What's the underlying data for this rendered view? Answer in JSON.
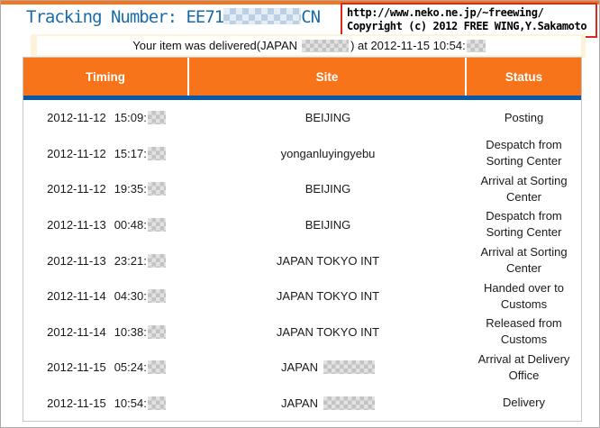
{
  "page": {
    "title_label": "Tracking Number: ",
    "tracking_prefix": "EE71",
    "tracking_suffix": "CN",
    "tracking_middle_redacted": true,
    "delivered_message": {
      "part1": "Your item was delivered(JAPAN",
      "site_redacted": true,
      "part2": ") at 2012-11-15 10:54:",
      "seconds_redacted": true
    },
    "copyright": {
      "line1": "http://www.neko.ne.jp/~freewing/",
      "line2": "Copyright (c) 2012 FREE WING,Y.Sakamoto"
    }
  },
  "colors": {
    "accent_orange": "#f7741b",
    "rule_blue": "#0858a8",
    "title_blue": "#1a6ba8",
    "copyright_border_red": "#e0271c",
    "message_band_cream": "#fcf3d9"
  },
  "table": {
    "headers": [
      "Timing",
      "Site",
      "Status"
    ],
    "rows": [
      {
        "date": "2012-11-12",
        "time": "15:09:",
        "seconds_redacted": true,
        "site": "BEIJING",
        "site_redacted": false,
        "status": "Posting"
      },
      {
        "date": "2012-11-12",
        "time": "15:17:",
        "seconds_redacted": true,
        "site": "yonganluyingyebu",
        "site_redacted": false,
        "status": "Despatch from Sorting Center"
      },
      {
        "date": "2012-11-12",
        "time": "19:35:",
        "seconds_redacted": true,
        "site": "BEIJING",
        "site_redacted": false,
        "status": "Arrival at Sorting Center"
      },
      {
        "date": "2012-11-13",
        "time": "00:48:",
        "seconds_redacted": true,
        "site": "BEIJING",
        "site_redacted": false,
        "status": "Despatch from Sorting Center"
      },
      {
        "date": "2012-11-13",
        "time": "23:21:",
        "seconds_redacted": true,
        "site": "JAPAN TOKYO INT",
        "site_redacted": false,
        "status": "Arrival at Sorting Center"
      },
      {
        "date": "2012-11-14",
        "time": "04:30:",
        "seconds_redacted": true,
        "site": "JAPAN TOKYO INT",
        "site_redacted": false,
        "status": "Handed over to Customs"
      },
      {
        "date": "2012-11-14",
        "time": "10:38:",
        "seconds_redacted": true,
        "site": "JAPAN TOKYO INT",
        "site_redacted": false,
        "status": "Released from Customs"
      },
      {
        "date": "2012-11-15",
        "time": "05:24:",
        "seconds_redacted": true,
        "site": "JAPAN",
        "site_redacted": true,
        "status": "Arrival at Delivery Office"
      },
      {
        "date": "2012-11-15",
        "time": "10:54:",
        "seconds_redacted": true,
        "site": "JAPAN",
        "site_redacted": true,
        "status": "Delivery"
      }
    ]
  }
}
